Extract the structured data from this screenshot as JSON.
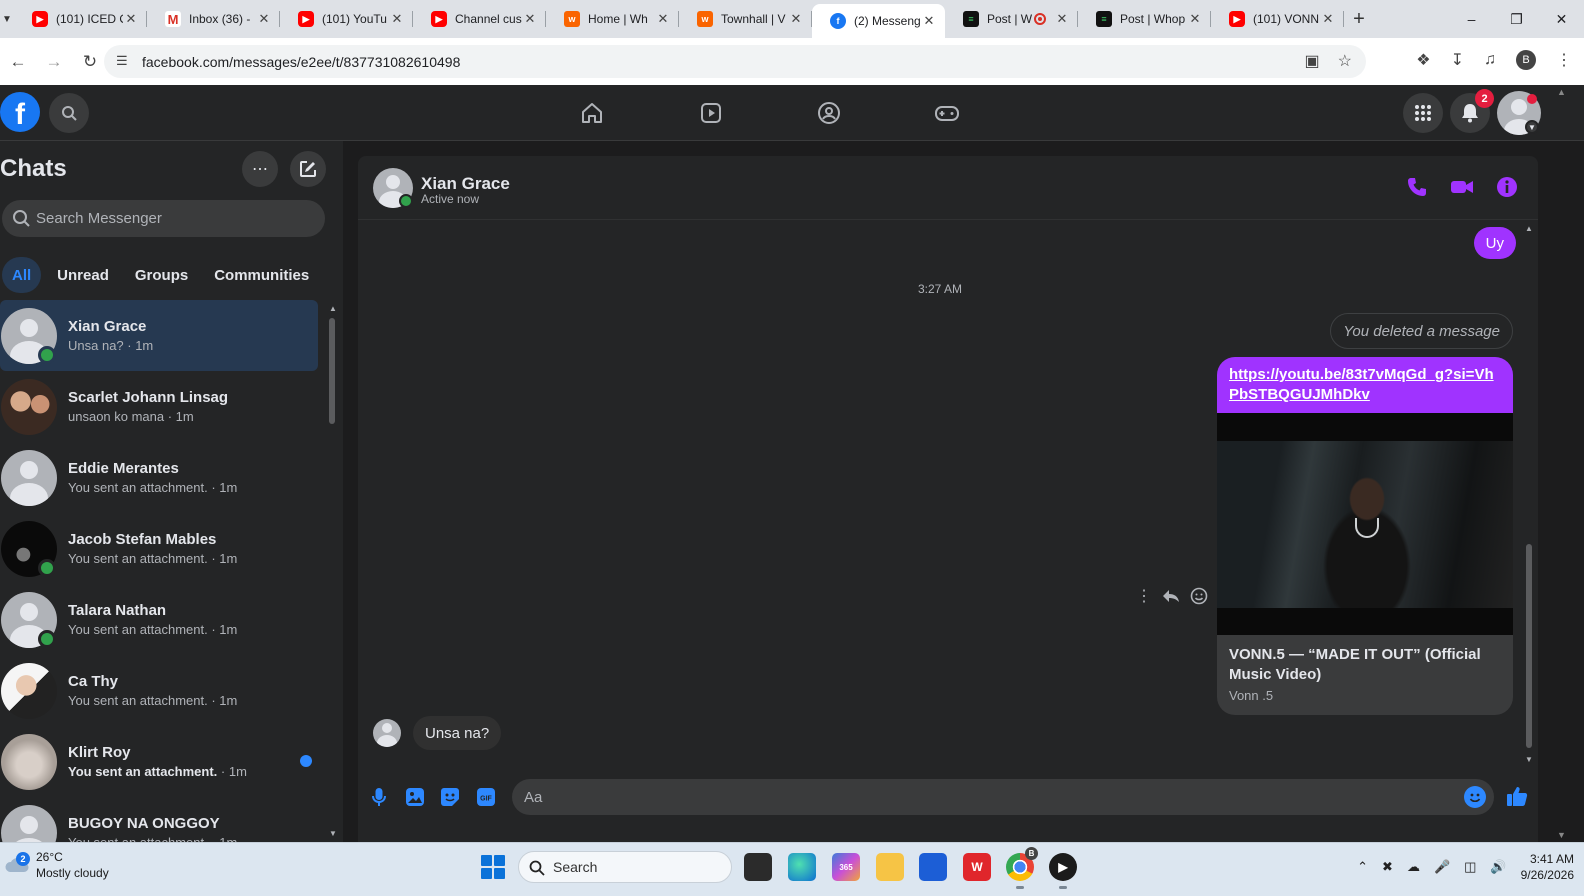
{
  "browser": {
    "tabs": [
      {
        "title": "(101) ICED O",
        "favicon": "youtube-icon",
        "active": false
      },
      {
        "title": "Inbox (36) -",
        "favicon": "gmail-icon",
        "active": false
      },
      {
        "title": "(101) YouTu",
        "favicon": "youtube-icon",
        "active": false
      },
      {
        "title": "Channel cus",
        "favicon": "youtube-icon",
        "active": false
      },
      {
        "title": "Home | Wh",
        "favicon": "whop-icon",
        "active": false
      },
      {
        "title": "Townhall | V",
        "favicon": "whop-icon",
        "active": false
      },
      {
        "title": "(2) Messeng",
        "favicon": "facebook-icon",
        "active": true
      },
      {
        "title": "Post | W",
        "favicon": "whop-post-icon",
        "active": false,
        "recording": true
      },
      {
        "title": "Post | Whop",
        "favicon": "whop-post-icon",
        "active": false
      },
      {
        "title": "(101) VONN",
        "favicon": "youtube-icon",
        "active": false
      }
    ],
    "url": "facebook.com/messages/e2ee/t/837731082610498",
    "profile_initial": "B"
  },
  "fb_nav": {
    "notifications_count": "2"
  },
  "sidebar": {
    "title": "Chats",
    "search_placeholder": "Search Messenger",
    "filters": [
      "All",
      "Unread",
      "Groups",
      "Communities"
    ],
    "chats": [
      {
        "name": "Xian Grace",
        "preview": "Unsa na? · 1m",
        "online": true,
        "active": true,
        "avatar": "default"
      },
      {
        "name": "Scarlet Johann Linsag",
        "preview": "unsaon ko mana · 1m",
        "online": false,
        "active": false,
        "avatar": "photo1"
      },
      {
        "name": "Eddie Merantes",
        "preview": "You sent an attachment. · 1m",
        "online": false,
        "active": false,
        "avatar": "default"
      },
      {
        "name": "Jacob Stefan Mables",
        "preview": "You sent an attachment. · 1m",
        "online": true,
        "active": false,
        "avatar": "photo2"
      },
      {
        "name": "Talara Nathan",
        "preview": "You sent an attachment. · 1m",
        "online": true,
        "active": false,
        "avatar": "default"
      },
      {
        "name": "Ca Thy",
        "preview": "You sent an attachment. · 1m",
        "online": false,
        "active": false,
        "avatar": "photo3"
      },
      {
        "name": "Klirt Roy",
        "preview": "You sent an attachment.",
        "preview_time": " · 1m",
        "online": false,
        "active": false,
        "unread": true,
        "avatar": "photo4"
      },
      {
        "name": "BUGOY NA ONGGOY",
        "preview": "You sent an attachment. · 1m",
        "online": false,
        "active": false,
        "avatar": "default"
      }
    ]
  },
  "conversation": {
    "contact_name": "Xian Grace",
    "contact_status": "Active now",
    "messages": {
      "sent_short": "Uy",
      "timestamp": "3:27 AM",
      "deleted_notice": "You deleted a message",
      "link_url": "https://youtu.be/83t7vMqGd_g?si=VhPbSTBQGUJMhDkv",
      "link_title": "VONN.5 — “MADE IT OUT” (Official Music Video)",
      "link_source": "Vonn .5",
      "received": "Unsa na?"
    },
    "composer_placeholder": "Aa",
    "accent_color": "#a033ff"
  },
  "taskbar": {
    "weather_temp": "26°C",
    "weather_desc": "Mostly cloudy",
    "weather_badge": "2",
    "search_label": "Search",
    "time": "3:41 AM",
    "date": "9/26/2026",
    "chrome_badge": "B"
  }
}
